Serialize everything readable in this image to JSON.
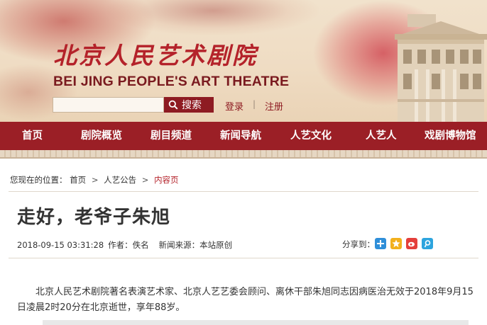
{
  "header": {
    "logo_cn": "北京人民艺术剧院",
    "logo_en": "BEI JING PEOPLE'S ART THEATRE",
    "search": {
      "placeholder": "",
      "button_label": "搜索"
    },
    "login_label": "登录",
    "separator": "|",
    "register_label": "注册"
  },
  "nav": {
    "items": [
      {
        "label": "首页"
      },
      {
        "label": "剧院概览"
      },
      {
        "label": "剧目频道"
      },
      {
        "label": "新闻导航"
      },
      {
        "label": "人艺文化"
      },
      {
        "label": "人艺人"
      },
      {
        "label": "戏剧博物馆"
      }
    ]
  },
  "breadcrumb": {
    "prefix": "您现在的位置：",
    "items": [
      "首页",
      "人艺公告",
      "内容页"
    ],
    "arrow": ">"
  },
  "article": {
    "title": "走好，老爷子朱旭",
    "datetime": "2018-09-15 03:31:28",
    "author_label": "作者：",
    "author": "佚名",
    "source_label": "新闻来源：",
    "source": "本站原创",
    "share_label": "分享到：",
    "share_icons": [
      "plus-share-icon",
      "qzone-icon",
      "weibo-icon",
      "tencent-weibo-icon"
    ],
    "body": "北京人民艺术剧院著名表演艺术家、北京人艺艺委会顾问、离休干部朱旭同志因病医治无效于2018年9月15日凌晨2时20分在北京逝世，享年88岁。"
  },
  "colors": {
    "brand_red": "#9b1f26",
    "logo_red": "#b4222a",
    "header_bg": "#efdcc3"
  }
}
